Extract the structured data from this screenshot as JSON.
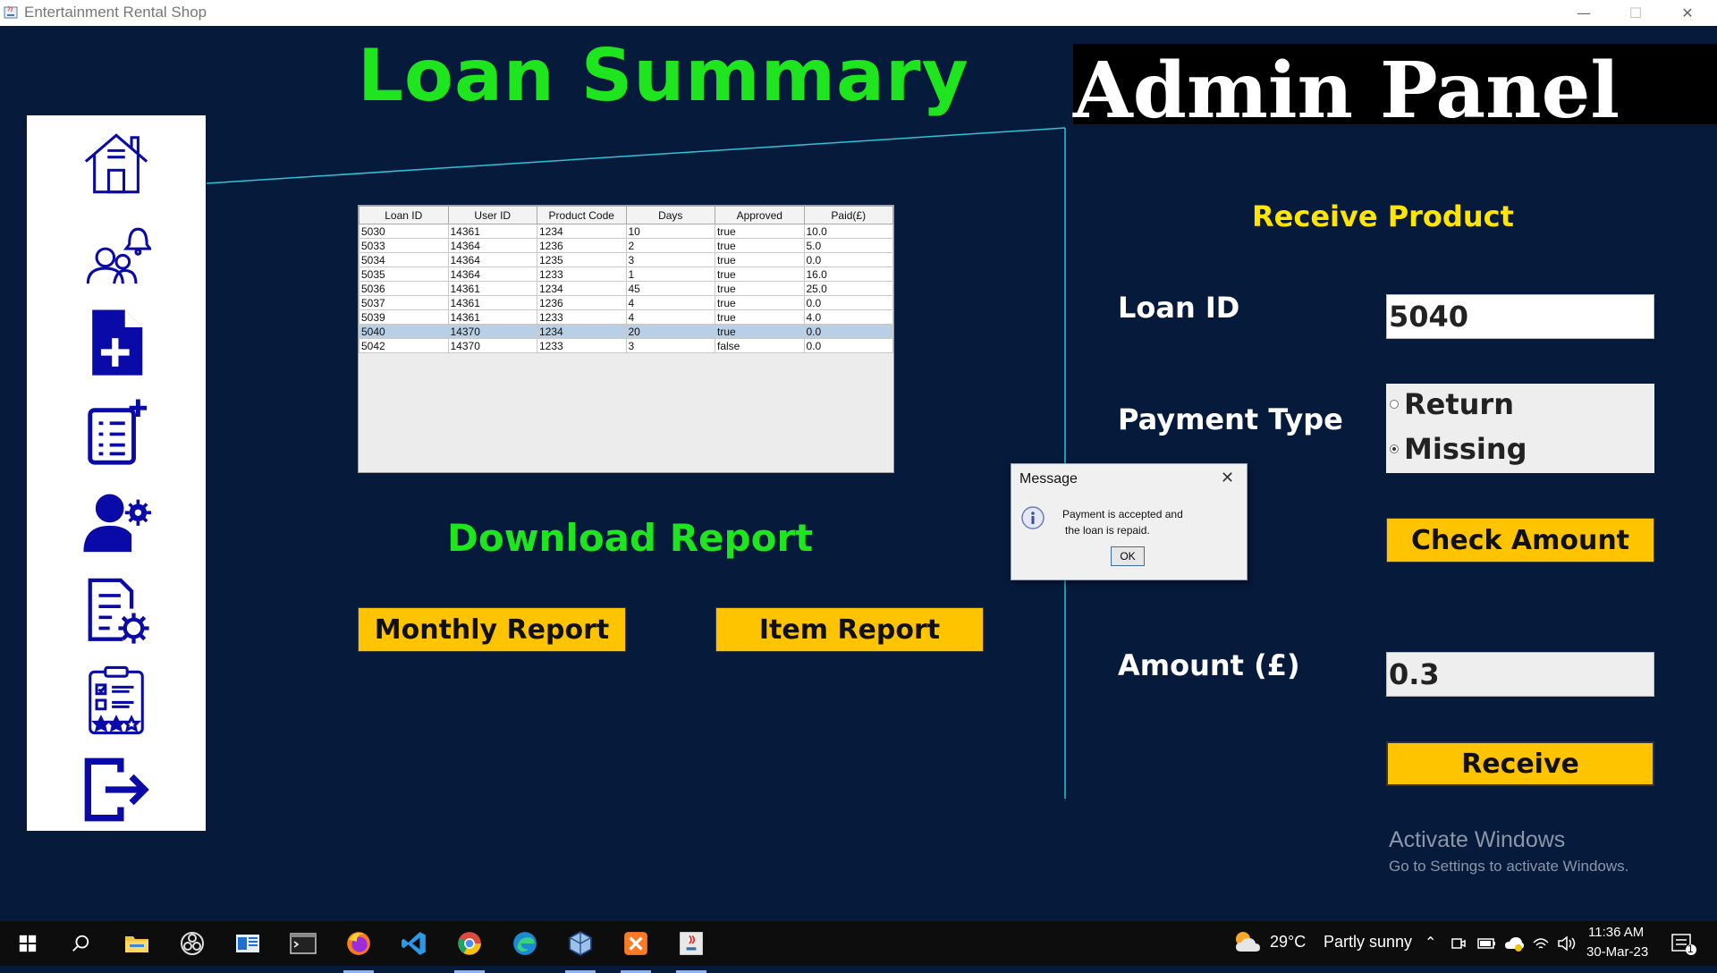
{
  "window": {
    "title": "Entertainment Rental Shop",
    "minimize": "—",
    "maximize": "☐",
    "close": "✕"
  },
  "header": {
    "title": "Loan Summary",
    "admin_panel": "Admin Panel"
  },
  "sidebar": {
    "items": [
      {
        "icon": "home-icon"
      },
      {
        "icon": "users-notification-icon"
      },
      {
        "icon": "add-document-icon"
      },
      {
        "icon": "add-list-icon"
      },
      {
        "icon": "user-settings-icon"
      },
      {
        "icon": "document-settings-icon"
      },
      {
        "icon": "clipboard-rating-icon"
      },
      {
        "icon": "logout-icon"
      }
    ],
    "icon_color": "#0a0aa8"
  },
  "table": {
    "columns": [
      "Loan ID",
      "User ID",
      "Product Code",
      "Days",
      "Approved",
      "Paid(£)"
    ],
    "rows": [
      [
        "5030",
        "14361",
        "1234",
        "10",
        "true",
        "10.0"
      ],
      [
        "5033",
        "14364",
        "1236",
        "2",
        "true",
        "5.0"
      ],
      [
        "5034",
        "14364",
        "1235",
        "3",
        "true",
        "0.0"
      ],
      [
        "5035",
        "14364",
        "1233",
        "1",
        "true",
        "16.0"
      ],
      [
        "5036",
        "14361",
        "1234",
        "45",
        "true",
        "25.0"
      ],
      [
        "5037",
        "14361",
        "1236",
        "4",
        "true",
        "0.0"
      ],
      [
        "5039",
        "14361",
        "1233",
        "4",
        "true",
        "4.0"
      ],
      [
        "5040",
        "14370",
        "1234",
        "20",
        "true",
        "0.0"
      ],
      [
        "5042",
        "14370",
        "1233",
        "3",
        "false",
        "0.0"
      ]
    ],
    "selected_row": 7
  },
  "report": {
    "title": "Download Report",
    "monthly_label": "Monthly Report",
    "item_label": "Item Report"
  },
  "receive": {
    "title": "Receive Product",
    "loan_id_label": "Loan ID",
    "loan_id_value": "5040",
    "payment_type_label": "Payment Type",
    "options": [
      "Return",
      "Missing"
    ],
    "selected_option": "Missing",
    "check_amount_label": "Check Amount",
    "amount_label": "Amount (£)",
    "amount_value": "0.3",
    "receive_label": "Receive"
  },
  "dialog": {
    "title": "Message",
    "line1": "Payment is accepted and",
    "line2": "the loan is repaid.",
    "ok_label": "OK"
  },
  "watermark": {
    "line1": "Activate Windows",
    "line2": "Go to Settings to activate Windows."
  },
  "taskbar": {
    "apps": [
      "windows-start-icon",
      "search-icon",
      "file-explorer-icon",
      "obs-icon",
      "news-icon",
      "terminal-icon",
      "firefox-icon",
      "vscode-icon",
      "chrome-icon",
      "edge-icon",
      "virtualbox-icon",
      "xampp-icon",
      "java-icon"
    ],
    "weather_temp": "29°C",
    "weather_desc": "Partly sunny",
    "time": "11:36 AM",
    "date": "30-Mar-23",
    "notification_count": "1"
  },
  "colors": {
    "background": "#061a3c",
    "green": "#1ee51e",
    "yellow_title": "#ffe500",
    "button": "#ffc400",
    "accent_line": "#2ec4d6"
  }
}
